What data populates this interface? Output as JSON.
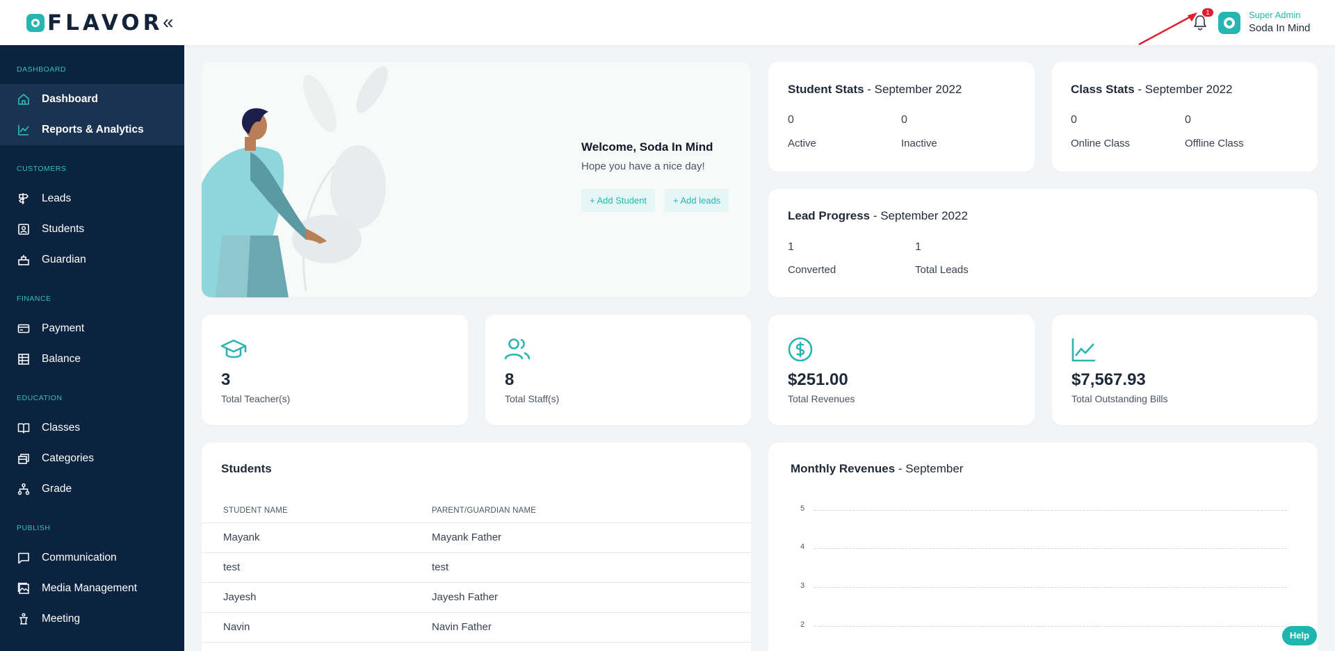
{
  "header": {
    "logo_text": "FLAVOR",
    "collapse_icon": "«",
    "notification_count": "1",
    "user_role": "Super Admin",
    "user_name": "Soda In Mind"
  },
  "sidebar": {
    "sections": [
      {
        "title": "DASHBOARD",
        "items": [
          {
            "label": "Dashboard",
            "icon": "home-icon",
            "active": true
          },
          {
            "label": "Reports & Analytics",
            "icon": "chart-line-icon",
            "active": true
          }
        ]
      },
      {
        "title": "CUSTOMERS",
        "items": [
          {
            "label": "Leads",
            "icon": "signpost-icon"
          },
          {
            "label": "Students",
            "icon": "id-card-icon"
          },
          {
            "label": "Guardian",
            "icon": "guardian-icon"
          }
        ]
      },
      {
        "title": "FINANCE",
        "items": [
          {
            "label": "Payment",
            "icon": "card-icon"
          },
          {
            "label": "Balance",
            "icon": "ledger-icon"
          }
        ]
      },
      {
        "title": "EDUCATION",
        "items": [
          {
            "label": "Classes",
            "icon": "book-icon"
          },
          {
            "label": "Categories",
            "icon": "stack-icon"
          },
          {
            "label": "Grade",
            "icon": "hierarchy-icon"
          }
        ]
      },
      {
        "title": "PUBLISH",
        "items": [
          {
            "label": "Communication",
            "icon": "chat-icon"
          },
          {
            "label": "Media Management",
            "icon": "gallery-icon"
          },
          {
            "label": "Meeting",
            "icon": "podium-icon"
          }
        ]
      }
    ]
  },
  "welcome": {
    "title": "Welcome, Soda In Mind",
    "subtitle": "Hope you have a nice day!",
    "add_student": "+ Add Student",
    "add_leads": "+ Add leads"
  },
  "student_stats": {
    "title": "Student Stats",
    "period": " - September 2022",
    "active_value": "0",
    "active_label": "Active",
    "inactive_value": "0",
    "inactive_label": "Inactive"
  },
  "class_stats": {
    "title": "Class Stats",
    "period": " - September 2022",
    "online_value": "0",
    "online_label": "Online Class",
    "offline_value": "0",
    "offline_label": "Offline Class"
  },
  "lead_progress": {
    "title": "Lead Progress",
    "period": " - September 2022",
    "converted_value": "1",
    "converted_label": "Converted",
    "total_value": "1",
    "total_label": "Total Leads"
  },
  "kpis": [
    {
      "value": "3",
      "label": "Total Teacher(s)",
      "icon": "graduation-cap-icon"
    },
    {
      "value": "8",
      "label": "Total Staff(s)",
      "icon": "users-icon"
    },
    {
      "value": "$251.00",
      "label": "Total Revenues",
      "icon": "dollar-circle-icon"
    },
    {
      "value": "$7,567.93",
      "label": "Total Outstanding Bills",
      "icon": "trend-icon"
    }
  ],
  "students_table": {
    "title": "Students",
    "columns": [
      "STUDENT NAME",
      "PARENT/GUARDIAN NAME"
    ],
    "rows": [
      [
        "Mayank",
        "Mayank Father"
      ],
      [
        "test",
        "test"
      ],
      [
        "Jayesh",
        "Jayesh Father"
      ],
      [
        "Navin",
        "Navin Father"
      ]
    ]
  },
  "revenue_chart": {
    "title": "Monthly Revenues",
    "period": " - September",
    "y_ticks": [
      "5",
      "4",
      "3",
      "2"
    ]
  },
  "chart_data": {
    "type": "line",
    "title": "Monthly Revenues - September",
    "xlabel": "",
    "ylabel": "",
    "y_ticks": [
      5,
      4,
      3,
      2
    ],
    "grid": true,
    "series": []
  },
  "help": "Help",
  "colors": {
    "accent": "#26b5b0",
    "sidebar": "#0c2340",
    "badge": "#e11d2e"
  }
}
